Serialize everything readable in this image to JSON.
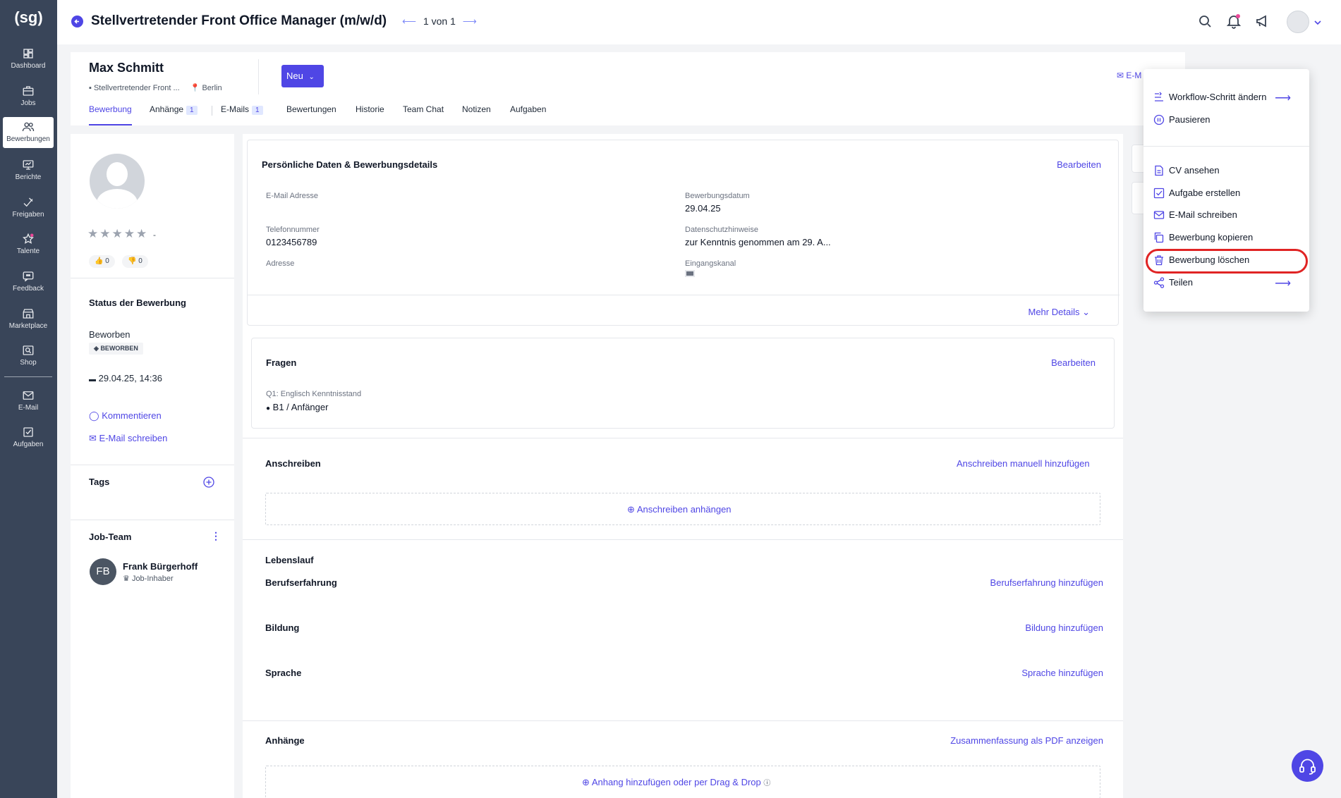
{
  "sidebar": {
    "logo": "(sg)",
    "items": [
      {
        "label": "Dashboard"
      },
      {
        "label": "Jobs"
      },
      {
        "label": "Bewerbungen"
      },
      {
        "label": "Berichte"
      },
      {
        "label": "Freigaben"
      },
      {
        "label": "Talente"
      },
      {
        "label": "Feedback"
      },
      {
        "label": "Marketplace"
      },
      {
        "label": "Shop"
      },
      {
        "label": "E-Mail"
      },
      {
        "label": "Aufgaben"
      }
    ]
  },
  "header": {
    "title": "Stellvertretender Front Office Manager (m/w/d)",
    "pager": "1 von 1"
  },
  "candidate": {
    "name": "Max Schmitt",
    "job": "Stellvertretender Front ...",
    "location": "Berlin",
    "status_button": "Neu",
    "email_link": "E-M",
    "tabs": [
      {
        "label": "Bewerbung"
      },
      {
        "label": "Anhänge",
        "badge": "1"
      },
      {
        "label": "E-Mails",
        "badge": "1"
      },
      {
        "label": "Bewertungen"
      },
      {
        "label": "Historie"
      },
      {
        "label": "Team Chat"
      },
      {
        "label": "Notizen"
      },
      {
        "label": "Aufgaben"
      }
    ]
  },
  "left": {
    "rating_dash": "-",
    "thumbs_up": "0",
    "thumbs_down": "0",
    "status_title": "Status der Bewerbung",
    "status_text": "Beworben",
    "status_badge": "BEWORBEN",
    "date": "29.04.25, 14:36",
    "comment_link": "Kommentieren",
    "email_link": "E-Mail schreiben",
    "tags_title": "Tags",
    "team_title": "Job-Team",
    "member_initials": "FB",
    "member_name": "Frank Bürgerhoff",
    "member_role": "Job-Inhaber"
  },
  "details": {
    "title": "Persönliche Daten & Bewerbungsdetails",
    "edit": "Bearbeiten",
    "email_label": "E-Mail Adresse",
    "phone_label": "Telefonnummer",
    "phone_value": "0123456789",
    "address_label": "Adresse",
    "date_label": "Bewerbungsdatum",
    "date_value": "29.04.25",
    "privacy_label": "Datenschutzhinweise",
    "privacy_value": "zur Kenntnis genommen am 29. A...",
    "channel_label": "Eingangskanal",
    "more": "Mehr Details"
  },
  "questions": {
    "title": "Fragen",
    "edit": "Bearbeiten",
    "q1_label": "Q1: Englisch Kenntnisstand",
    "q1_value": "B1 / Anfänger"
  },
  "cover": {
    "title": "Anschreiben",
    "add_manual": "Anschreiben manuell hinzufügen",
    "attach": "Anschreiben anhängen"
  },
  "cv": {
    "title": "Lebenslauf",
    "experience": "Berufserfahrung",
    "experience_add": "Berufserfahrung hinzufügen",
    "education": "Bildung",
    "education_add": "Bildung hinzufügen",
    "language": "Sprache",
    "language_add": "Sprache hinzufügen"
  },
  "attachments": {
    "title": "Anhänge",
    "pdf_link": "Zusammenfassung als PDF anzeigen",
    "add": "Anhang hinzufügen oder per Drag & Drop"
  },
  "menu": {
    "items": [
      {
        "label": "Workflow-Schritt ändern",
        "icon": "workflow-icon"
      },
      {
        "label": "Pausieren",
        "icon": "pause-icon"
      },
      {
        "label": "CV ansehen",
        "icon": "document-icon"
      },
      {
        "label": "Aufgabe erstellen",
        "icon": "checkbox-icon"
      },
      {
        "label": "E-Mail schreiben",
        "icon": "mail-icon"
      },
      {
        "label": "Bewerbung kopieren",
        "icon": "copy-icon"
      },
      {
        "label": "Bewerbung löschen",
        "icon": "trash-icon"
      },
      {
        "label": "Teilen",
        "icon": "share-icon"
      }
    ]
  },
  "colors": {
    "accent": "#4f46e5",
    "sidebar": "#394559",
    "highlight": "#e02424"
  }
}
